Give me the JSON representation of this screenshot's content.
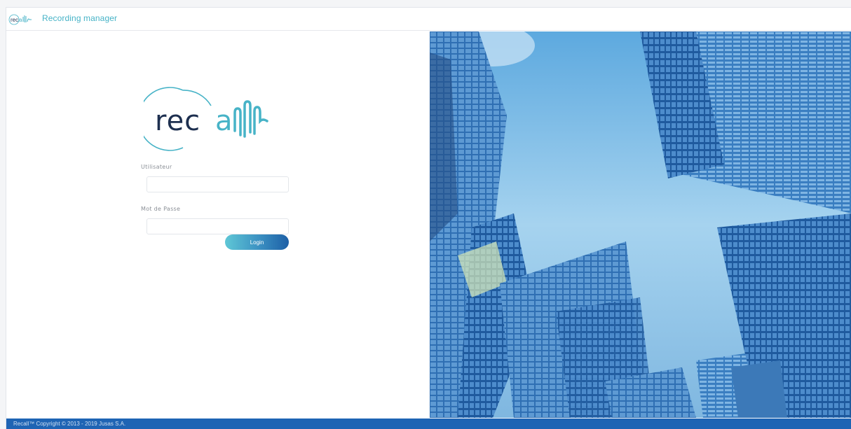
{
  "header": {
    "logo_icon": "recall-logo-icon",
    "title": "Recording manager"
  },
  "login": {
    "brand_logo": "recall-logo-icon",
    "username_label": "Utilisateur",
    "username_value": "",
    "password_label": "Mot de Passe",
    "password_value": "",
    "login_label": "Login"
  },
  "footer": {
    "copyright": "Recall™ Copyright © 2013 - 2019 Jusas S.A."
  },
  "colors": {
    "brand_teal": "#47b3c7",
    "brand_navy": "#1d2f4f",
    "footer_blue": "#1e64b4",
    "button_start": "#5fc7d6",
    "button_end": "#1d5fa6"
  },
  "background_image": "city-skyscrapers-image"
}
